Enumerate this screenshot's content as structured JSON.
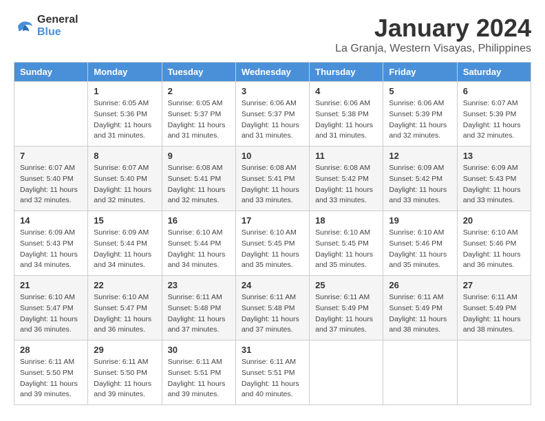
{
  "header": {
    "logo_line1": "General",
    "logo_line2": "Blue",
    "month_title": "January 2024",
    "subtitle": "La Granja, Western Visayas, Philippines"
  },
  "calendar": {
    "days_of_week": [
      "Sunday",
      "Monday",
      "Tuesday",
      "Wednesday",
      "Thursday",
      "Friday",
      "Saturday"
    ],
    "weeks": [
      [
        {
          "day": "",
          "sunrise": "",
          "sunset": "",
          "daylight": ""
        },
        {
          "day": "1",
          "sunrise": "Sunrise: 6:05 AM",
          "sunset": "Sunset: 5:36 PM",
          "daylight": "Daylight: 11 hours and 31 minutes."
        },
        {
          "day": "2",
          "sunrise": "Sunrise: 6:05 AM",
          "sunset": "Sunset: 5:37 PM",
          "daylight": "Daylight: 11 hours and 31 minutes."
        },
        {
          "day": "3",
          "sunrise": "Sunrise: 6:06 AM",
          "sunset": "Sunset: 5:37 PM",
          "daylight": "Daylight: 11 hours and 31 minutes."
        },
        {
          "day": "4",
          "sunrise": "Sunrise: 6:06 AM",
          "sunset": "Sunset: 5:38 PM",
          "daylight": "Daylight: 11 hours and 31 minutes."
        },
        {
          "day": "5",
          "sunrise": "Sunrise: 6:06 AM",
          "sunset": "Sunset: 5:39 PM",
          "daylight": "Daylight: 11 hours and 32 minutes."
        },
        {
          "day": "6",
          "sunrise": "Sunrise: 6:07 AM",
          "sunset": "Sunset: 5:39 PM",
          "daylight": "Daylight: 11 hours and 32 minutes."
        }
      ],
      [
        {
          "day": "7",
          "sunrise": "Sunrise: 6:07 AM",
          "sunset": "Sunset: 5:40 PM",
          "daylight": "Daylight: 11 hours and 32 minutes."
        },
        {
          "day": "8",
          "sunrise": "Sunrise: 6:07 AM",
          "sunset": "Sunset: 5:40 PM",
          "daylight": "Daylight: 11 hours and 32 minutes."
        },
        {
          "day": "9",
          "sunrise": "Sunrise: 6:08 AM",
          "sunset": "Sunset: 5:41 PM",
          "daylight": "Daylight: 11 hours and 32 minutes."
        },
        {
          "day": "10",
          "sunrise": "Sunrise: 6:08 AM",
          "sunset": "Sunset: 5:41 PM",
          "daylight": "Daylight: 11 hours and 33 minutes."
        },
        {
          "day": "11",
          "sunrise": "Sunrise: 6:08 AM",
          "sunset": "Sunset: 5:42 PM",
          "daylight": "Daylight: 11 hours and 33 minutes."
        },
        {
          "day": "12",
          "sunrise": "Sunrise: 6:09 AM",
          "sunset": "Sunset: 5:42 PM",
          "daylight": "Daylight: 11 hours and 33 minutes."
        },
        {
          "day": "13",
          "sunrise": "Sunrise: 6:09 AM",
          "sunset": "Sunset: 5:43 PM",
          "daylight": "Daylight: 11 hours and 33 minutes."
        }
      ],
      [
        {
          "day": "14",
          "sunrise": "Sunrise: 6:09 AM",
          "sunset": "Sunset: 5:43 PM",
          "daylight": "Daylight: 11 hours and 34 minutes."
        },
        {
          "day": "15",
          "sunrise": "Sunrise: 6:09 AM",
          "sunset": "Sunset: 5:44 PM",
          "daylight": "Daylight: 11 hours and 34 minutes."
        },
        {
          "day": "16",
          "sunrise": "Sunrise: 6:10 AM",
          "sunset": "Sunset: 5:44 PM",
          "daylight": "Daylight: 11 hours and 34 minutes."
        },
        {
          "day": "17",
          "sunrise": "Sunrise: 6:10 AM",
          "sunset": "Sunset: 5:45 PM",
          "daylight": "Daylight: 11 hours and 35 minutes."
        },
        {
          "day": "18",
          "sunrise": "Sunrise: 6:10 AM",
          "sunset": "Sunset: 5:45 PM",
          "daylight": "Daylight: 11 hours and 35 minutes."
        },
        {
          "day": "19",
          "sunrise": "Sunrise: 6:10 AM",
          "sunset": "Sunset: 5:46 PM",
          "daylight": "Daylight: 11 hours and 35 minutes."
        },
        {
          "day": "20",
          "sunrise": "Sunrise: 6:10 AM",
          "sunset": "Sunset: 5:46 PM",
          "daylight": "Daylight: 11 hours and 36 minutes."
        }
      ],
      [
        {
          "day": "21",
          "sunrise": "Sunrise: 6:10 AM",
          "sunset": "Sunset: 5:47 PM",
          "daylight": "Daylight: 11 hours and 36 minutes."
        },
        {
          "day": "22",
          "sunrise": "Sunrise: 6:10 AM",
          "sunset": "Sunset: 5:47 PM",
          "daylight": "Daylight: 11 hours and 36 minutes."
        },
        {
          "day": "23",
          "sunrise": "Sunrise: 6:11 AM",
          "sunset": "Sunset: 5:48 PM",
          "daylight": "Daylight: 11 hours and 37 minutes."
        },
        {
          "day": "24",
          "sunrise": "Sunrise: 6:11 AM",
          "sunset": "Sunset: 5:48 PM",
          "daylight": "Daylight: 11 hours and 37 minutes."
        },
        {
          "day": "25",
          "sunrise": "Sunrise: 6:11 AM",
          "sunset": "Sunset: 5:49 PM",
          "daylight": "Daylight: 11 hours and 37 minutes."
        },
        {
          "day": "26",
          "sunrise": "Sunrise: 6:11 AM",
          "sunset": "Sunset: 5:49 PM",
          "daylight": "Daylight: 11 hours and 38 minutes."
        },
        {
          "day": "27",
          "sunrise": "Sunrise: 6:11 AM",
          "sunset": "Sunset: 5:49 PM",
          "daylight": "Daylight: 11 hours and 38 minutes."
        }
      ],
      [
        {
          "day": "28",
          "sunrise": "Sunrise: 6:11 AM",
          "sunset": "Sunset: 5:50 PM",
          "daylight": "Daylight: 11 hours and 39 minutes."
        },
        {
          "day": "29",
          "sunrise": "Sunrise: 6:11 AM",
          "sunset": "Sunset: 5:50 PM",
          "daylight": "Daylight: 11 hours and 39 minutes."
        },
        {
          "day": "30",
          "sunrise": "Sunrise: 6:11 AM",
          "sunset": "Sunset: 5:51 PM",
          "daylight": "Daylight: 11 hours and 39 minutes."
        },
        {
          "day": "31",
          "sunrise": "Sunrise: 6:11 AM",
          "sunset": "Sunset: 5:51 PM",
          "daylight": "Daylight: 11 hours and 40 minutes."
        },
        {
          "day": "",
          "sunrise": "",
          "sunset": "",
          "daylight": ""
        },
        {
          "day": "",
          "sunrise": "",
          "sunset": "",
          "daylight": ""
        },
        {
          "day": "",
          "sunrise": "",
          "sunset": "",
          "daylight": ""
        }
      ]
    ]
  }
}
